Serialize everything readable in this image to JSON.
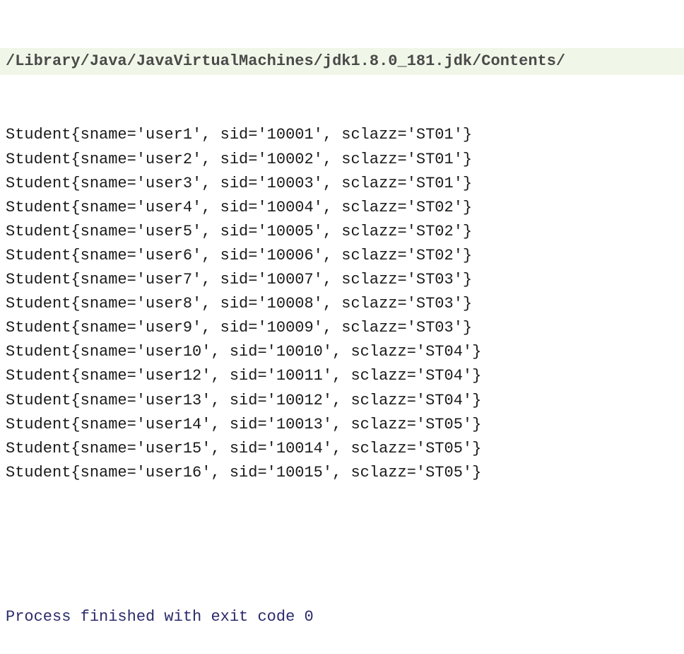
{
  "header": "/Library/Java/JavaVirtualMachines/jdk1.8.0_181.jdk/Contents/",
  "students": [
    {
      "sname": "user1",
      "sid": "10001",
      "sclazz": "ST01"
    },
    {
      "sname": "user2",
      "sid": "10002",
      "sclazz": "ST01"
    },
    {
      "sname": "user3",
      "sid": "10003",
      "sclazz": "ST01"
    },
    {
      "sname": "user4",
      "sid": "10004",
      "sclazz": "ST02"
    },
    {
      "sname": "user5",
      "sid": "10005",
      "sclazz": "ST02"
    },
    {
      "sname": "user6",
      "sid": "10006",
      "sclazz": "ST02"
    },
    {
      "sname": "user7",
      "sid": "10007",
      "sclazz": "ST03"
    },
    {
      "sname": "user8",
      "sid": "10008",
      "sclazz": "ST03"
    },
    {
      "sname": "user9",
      "sid": "10009",
      "sclazz": "ST03"
    },
    {
      "sname": "user10",
      "sid": "10010",
      "sclazz": "ST04"
    },
    {
      "sname": "user12",
      "sid": "10011",
      "sclazz": "ST04"
    },
    {
      "sname": "user13",
      "sid": "10012",
      "sclazz": "ST04"
    },
    {
      "sname": "user14",
      "sid": "10013",
      "sclazz": "ST05"
    },
    {
      "sname": "user15",
      "sid": "10014",
      "sclazz": "ST05"
    },
    {
      "sname": "user16",
      "sid": "10015",
      "sclazz": "ST05"
    }
  ],
  "exit_message": "Process finished with exit code 0"
}
